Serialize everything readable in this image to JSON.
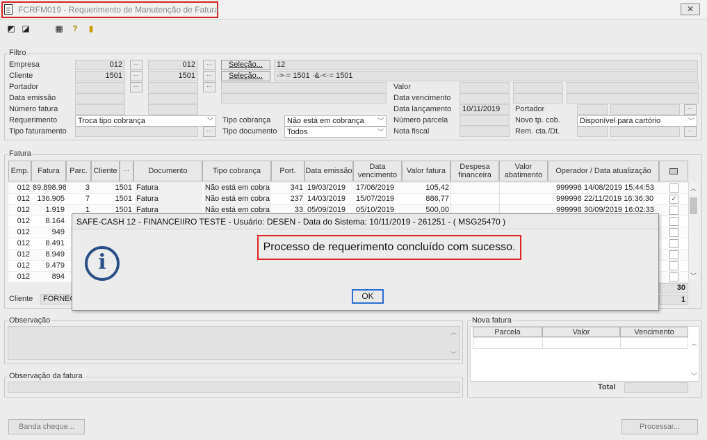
{
  "window": {
    "title": "FCRFM019 - Requerimento de Manutenção de Fatura",
    "close_label": "✕"
  },
  "filtro": {
    "legend": "Filtro",
    "empresa": {
      "label": "Empresa",
      "from": "012",
      "to": "012",
      "selection_button": "Seleção...",
      "selection_value": "12"
    },
    "cliente": {
      "label": "Cliente",
      "from": "1501",
      "to": "1501",
      "selection_button": "Seleção...",
      "selection_value": "·>·= 1501 ·&·<·= 1501"
    },
    "portador": {
      "label": "Portador"
    },
    "data_emissao": {
      "label": "Data emissão"
    },
    "numero_fatura": {
      "label": "Número fatura"
    },
    "requerimento": {
      "label": "Requerimento",
      "value": "Troca tipo cobrança"
    },
    "tipo_faturamento": {
      "label": "Tipo faturamento"
    },
    "tipo_cobranca": {
      "label": "Tipo cobrança",
      "value": "Não está em cobrança"
    },
    "tipo_documento": {
      "label": "Tipo documento",
      "value": "Todos"
    },
    "valor": {
      "label": "Valor"
    },
    "data_vencimento": {
      "label": "Data vencimento"
    },
    "data_lancamento": {
      "label": "Data lançamento",
      "value": "10/11/2019"
    },
    "portador2": {
      "label": "Portador"
    },
    "numero_parcela": {
      "label": "Número parcela"
    },
    "novo_tp_cob": {
      "label": "Novo tp. cob.",
      "value": "Disponível para cartório"
    },
    "nota_fiscal": {
      "label": "Nota fiscal"
    },
    "rem_cta_dt": {
      "label": "Rem. cta./Dt."
    }
  },
  "fatura": {
    "legend": "Fatura",
    "columns": [
      "Emp.",
      "Fatura",
      "Parc.",
      "Cliente",
      "",
      "Documento",
      "Tipo cobrança",
      "Port.",
      "Data emissão",
      "Data vencimento",
      "Valor fatura",
      "Despesa financeira",
      "Valor abatimento",
      "Operador / Data atualização"
    ],
    "rows": [
      {
        "emp": "012",
        "fatura": "89.898.98",
        "parc": "3",
        "cliente": "1501",
        "doc": "Fatura",
        "tipo": "Não está em cobra",
        "port": "341",
        "emissao": "19/03/2019",
        "venc": "17/06/2019",
        "valor": "105,42",
        "operador": "999998",
        "dt": "14/08/2019 15:44:53",
        "check": ""
      },
      {
        "emp": "012",
        "fatura": "136.905",
        "parc": "7",
        "cliente": "1501",
        "doc": "Fatura",
        "tipo": "Não está em cobra",
        "port": "237",
        "emissao": "14/03/2019",
        "venc": "15/07/2019",
        "valor": "886,77",
        "operador": "999998",
        "dt": "22/11/2019 16:36:30",
        "check": "✓"
      },
      {
        "emp": "012",
        "fatura": "1.919",
        "parc": "1",
        "cliente": "1501",
        "doc": "Fatura",
        "tipo": "Não está em cobra",
        "port": "33",
        "emissao": "05/09/2019",
        "venc": "05/10/2019",
        "valor": "500,00",
        "operador": "999998",
        "dt": "30/09/2019 16:02:33",
        "check": ""
      },
      {
        "emp": "012",
        "fatura": "8.164",
        "check": ""
      },
      {
        "emp": "012",
        "fatura": "949",
        "check": ""
      },
      {
        "emp": "012",
        "fatura": "8.491",
        "check": ""
      },
      {
        "emp": "012",
        "fatura": "8.949",
        "check": ""
      },
      {
        "emp": "012",
        "fatura": "9.479",
        "check": ""
      },
      {
        "emp": "012",
        "fatura": "894",
        "check": ""
      }
    ],
    "total_count": "30",
    "selected_count": "1",
    "cliente_label": "Cliente",
    "cliente_value": "FORNEC"
  },
  "observacao": {
    "legend": "Observação"
  },
  "observacao_fatura": {
    "legend": "Observação da fatura"
  },
  "nova_fatura": {
    "legend": "Nova fatura",
    "columns": [
      "Parcela",
      "Valor",
      "Vencimento"
    ],
    "total_label": "Total"
  },
  "buttons": {
    "banda_cheque": "Banda cheque...",
    "processar": "Processar..."
  },
  "dialog": {
    "title": "SAFE-CASH 12 - FINANCEIIRO TESTE - Usuário: DESEN - Data do Sistema: 10/11/2019 - 261251 - ( MSG25470 )",
    "message": "Processo de requerimento concluído com sucesso.",
    "ok": "OK",
    "icon_glyph": "i"
  }
}
